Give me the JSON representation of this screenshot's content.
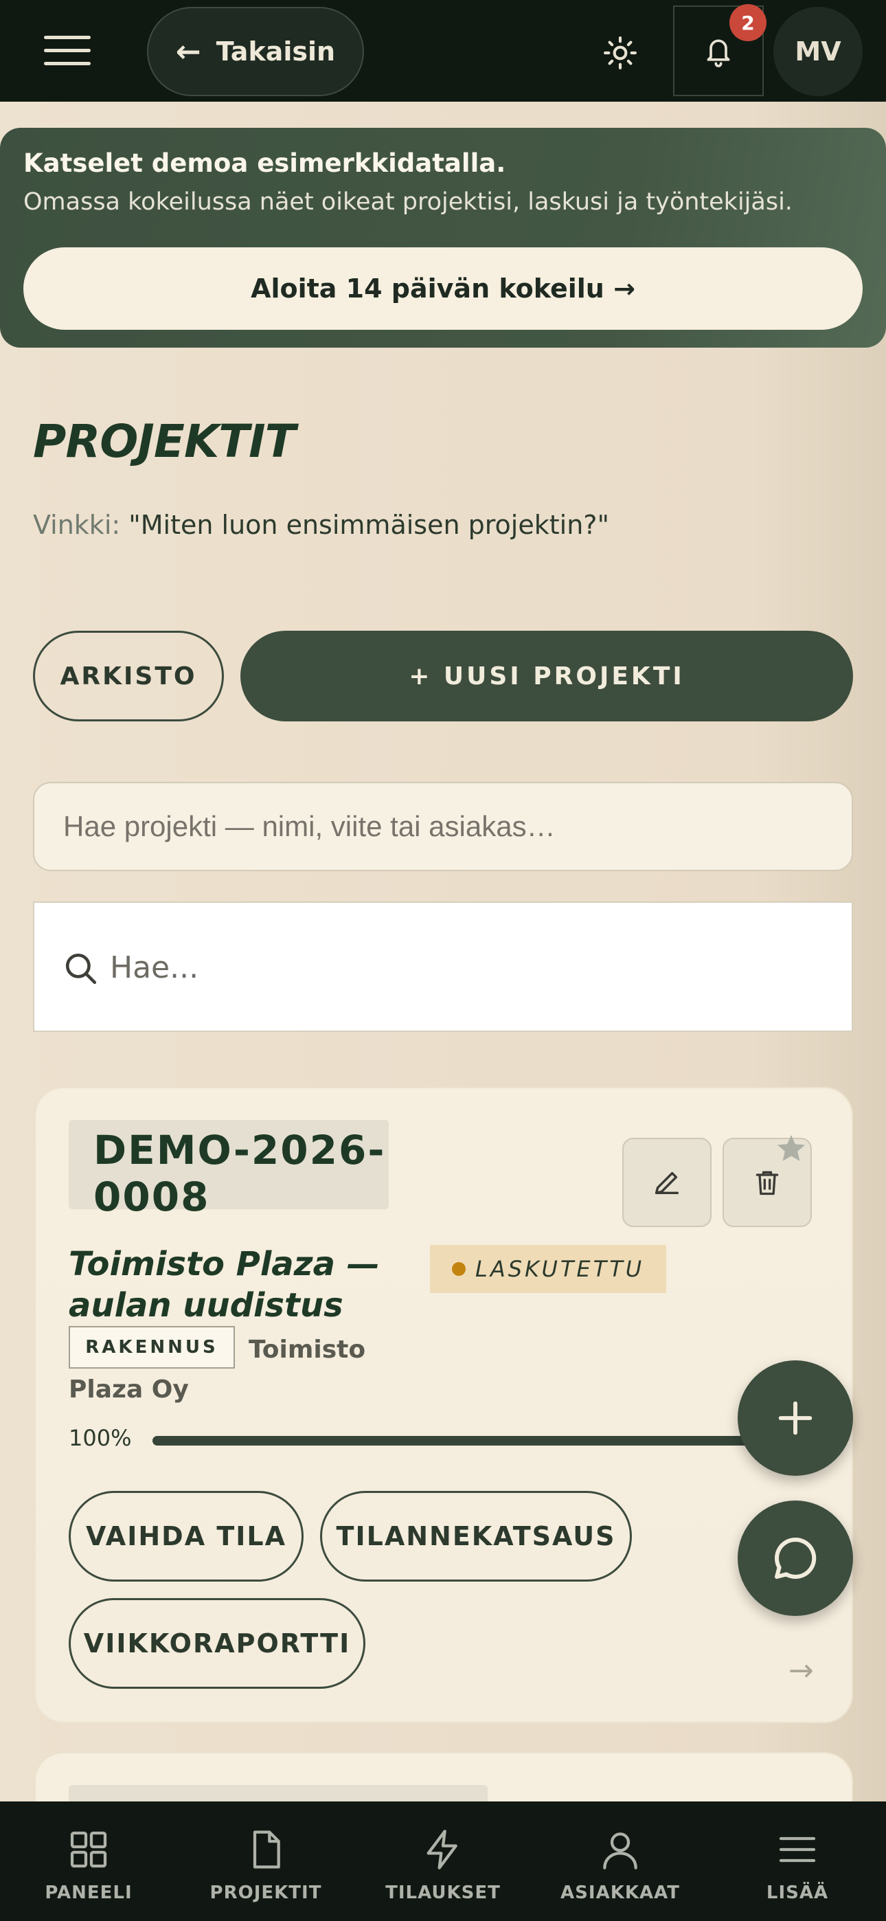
{
  "topbar": {
    "back_label": "Takaisin",
    "notifications_count": "2",
    "avatar_initials": "MV"
  },
  "banner": {
    "title": "Katselet demoa esimerkkidatalla.",
    "text": "Omassa kokeilussa näet oikeat projektisi, laskusi ja työntekijäsi.",
    "cta": "Aloita 14 päivän kokeilu →"
  },
  "page": {
    "title": "PROJEKTIT",
    "tip_label": "Vinkki:",
    "tip_text": "\"Miten luon ensimmäisen projektin?\"",
    "archive_label": "ARKISTO",
    "new_project_label": "+ UUSI PROJEKTI",
    "project_search_placeholder": "Hae projekti — nimi, viite tai asiakas…",
    "search_placeholder": "Hae..."
  },
  "projects": [
    {
      "reference": "DEMO-2026-0008",
      "title": "Toimisto Plaza — aulan uudistus",
      "status": "LASKUTETTU",
      "status_color": "#c3830f",
      "type": "RAKENNUS",
      "client": "Toimisto Plaza Oy",
      "progress_label": "100%",
      "progress": 1.0,
      "actions": [
        "VAIHDA TILA",
        "TILANNEKATSAUS",
        "VIIKKORAPORTTI"
      ],
      "open_arrow": "→"
    }
  ],
  "bottom_nav": [
    {
      "label": "PANEELI",
      "icon": "grid-icon"
    },
    {
      "label": "PROJEKTIT",
      "icon": "document-icon"
    },
    {
      "label": "TILAUKSET",
      "icon": "lightning-icon"
    },
    {
      "label": "ASIAKKAAT",
      "icon": "user-icon"
    },
    {
      "label": "LISÄÄ",
      "icon": "menu-icon"
    }
  ],
  "colors": {
    "topbar": "#0f1912",
    "accent": "#3d4d3e",
    "badge": "#c9483a",
    "background": "#ede1cf"
  }
}
